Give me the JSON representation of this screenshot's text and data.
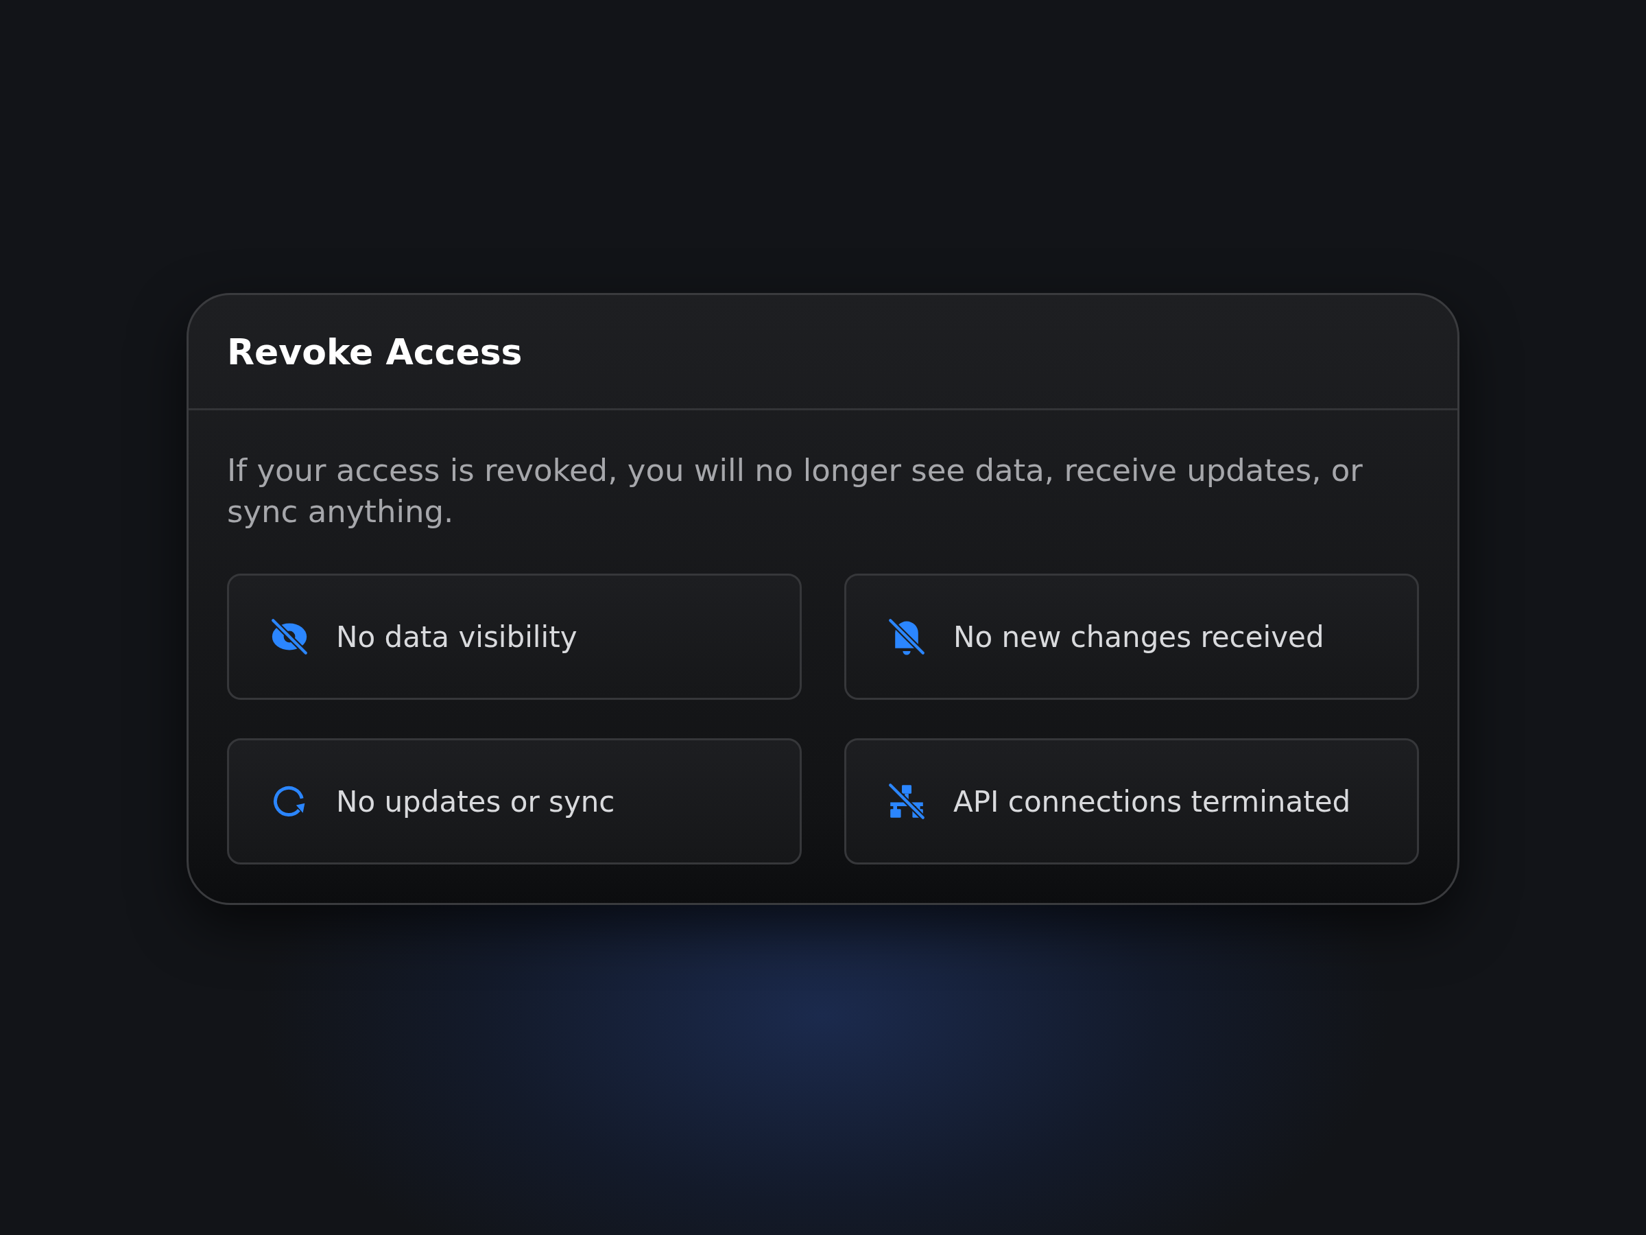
{
  "dialog": {
    "title": "Revoke Access",
    "description": "If your access is revoked, you will no longer see data, receive updates, or sync anything.",
    "items": [
      {
        "kind": "eye-off",
        "label": "No data visibility"
      },
      {
        "kind": "bell-off",
        "label": "No new changes received"
      },
      {
        "kind": "refresh",
        "label": "No updates or sync"
      },
      {
        "kind": "network-off",
        "label": "API connections terminated"
      }
    ]
  }
}
